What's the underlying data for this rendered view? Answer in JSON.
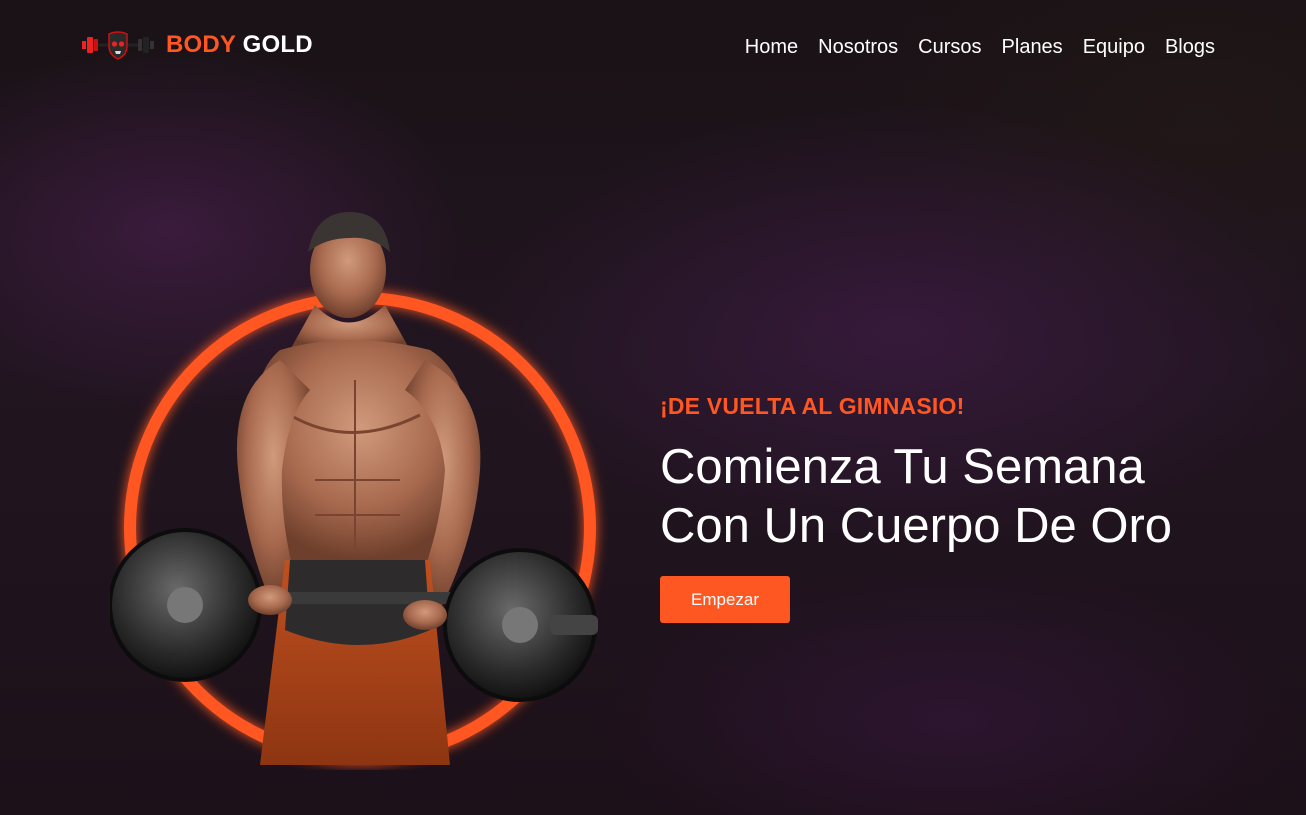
{
  "brand": {
    "name_part1": "BODY",
    "name_part2": "GOLD",
    "logo_icon": "barbell-skull-logo"
  },
  "nav": {
    "items": [
      {
        "label": "Home"
      },
      {
        "label": "Nosotros"
      },
      {
        "label": "Cursos"
      },
      {
        "label": "Planes"
      },
      {
        "label": "Equipo"
      },
      {
        "label": "Blogs"
      }
    ]
  },
  "hero": {
    "eyebrow": "¡DE VUELTA AL GIMNASIO!",
    "headline_line1": "Comienza Tu Semana",
    "headline_line2": "Con Un Cuerpo De Oro",
    "cta_label": "Empezar",
    "image_subject": "bodybuilder-lifting-barbell"
  },
  "colors": {
    "accent": "#ff5722",
    "text": "#ffffff",
    "background": "#1d1219"
  }
}
